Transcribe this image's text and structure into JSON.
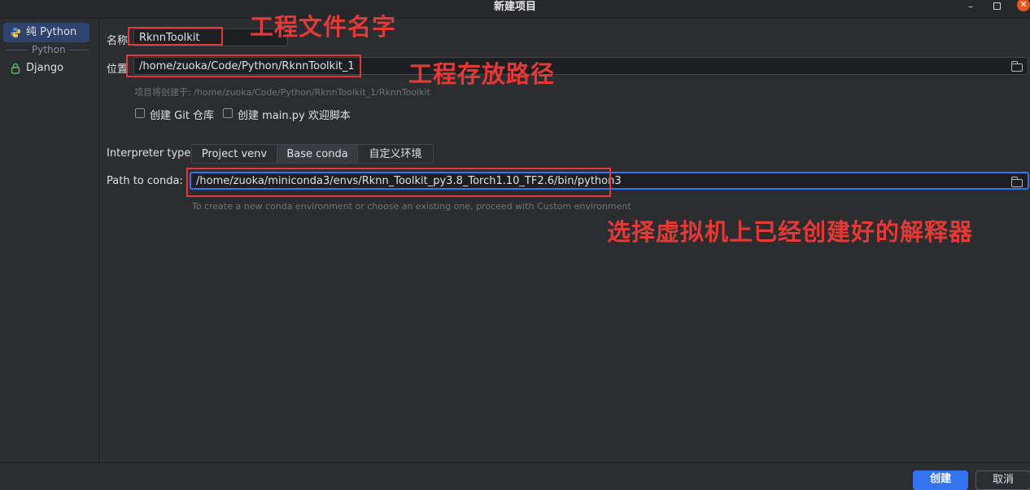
{
  "window": {
    "title": "新建项目",
    "minimize": "–",
    "close": "✕"
  },
  "sidebar": {
    "items": [
      {
        "label": "纯 Python",
        "icon": "python-icon",
        "selected": true
      },
      {
        "label": "Django",
        "icon": "lock-icon",
        "selected": false
      }
    ],
    "group_label": "Python"
  },
  "form": {
    "name_label": "名称",
    "name_value": "RknnToolkit",
    "location_label": "位置",
    "location_value": "/home/zuoka/Code/Python/RknnToolkit_1",
    "create_hint": "项目将创建于: /home/zuoka/Code/Python/RknnToolkit_1/RknnToolkit",
    "git_checkbox": "创建 Git 仓库",
    "main_checkbox": "创建 main.py 欢迎脚本",
    "interpreter_label": "Interpreter type:",
    "interpreter_tabs": [
      {
        "label": "Project venv",
        "selected": false
      },
      {
        "label": "Base conda",
        "selected": true
      },
      {
        "label": "自定义环境",
        "selected": false
      }
    ],
    "conda_label": "Path to conda:",
    "conda_value": "/home/zuoka/miniconda3/envs/Rknn_Toolkit_py3.8_Torch1.10_TF2.6/bin/python3",
    "conda_hint": "To create a new conda environment or choose an existing one, proceed with Custom environment"
  },
  "annotations": {
    "name_note": "工程文件名字",
    "path_note": "工程存放路径",
    "interpreter_note": "选择虚拟机上已经创建好的解释器",
    "color": "#e53935"
  },
  "footer": {
    "create_button": "创建",
    "cancel_button": "取消"
  },
  "colors": {
    "accent": "#3574f0",
    "background": "#2b2d30",
    "selection": "#2e436e"
  }
}
